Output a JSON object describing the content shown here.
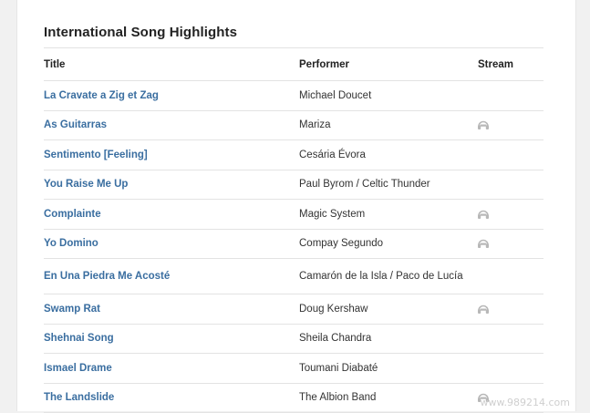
{
  "title": "International Song Highlights",
  "columns": {
    "title": "Title",
    "performer": "Performer",
    "stream": "Stream"
  },
  "rows": [
    {
      "title": "La Cravate a Zig et Zag",
      "performer": "Michael Doucet",
      "stream": false
    },
    {
      "title": "As Guitarras",
      "performer": "Mariza",
      "stream": true
    },
    {
      "title": "Sentimento [Feeling]",
      "performer": "Cesária Évora",
      "stream": false
    },
    {
      "title": "You Raise Me Up",
      "performer": "Paul Byrom / Celtic Thunder",
      "stream": false
    },
    {
      "title": "Complainte",
      "performer": "Magic System",
      "stream": true
    },
    {
      "title": "Yo Domino",
      "performer": "Compay Segundo",
      "stream": true
    },
    {
      "title": "En Una Piedra Me Acosté",
      "performer": "Camarón de la Isla / Paco de Lucía",
      "stream": false
    },
    {
      "title": "Swamp Rat",
      "performer": "Doug Kershaw",
      "stream": true
    },
    {
      "title": "Shehnai Song",
      "performer": "Sheila Chandra",
      "stream": false
    },
    {
      "title": "Ismael Drame",
      "performer": "Toumani Diabaté",
      "stream": false
    },
    {
      "title": "The Landslide",
      "performer": "The Albion Band",
      "stream": true
    }
  ],
  "icons": {
    "stream": "headphones-icon"
  },
  "colors": {
    "link": "#3a6ea0",
    "icon": "#b8b8b8"
  },
  "watermark": "www.989214.com"
}
